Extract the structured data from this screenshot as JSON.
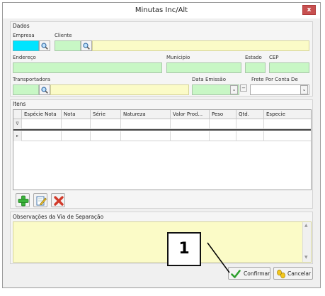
{
  "window": {
    "title": "Minutas Inc/Alt",
    "close_label": "x"
  },
  "dados": {
    "group_label": "Dados",
    "empresa_label": "Empresa",
    "cliente_label": "Cliente",
    "endereco_label": "Endereço",
    "municipio_label": "Municipio",
    "estado_label": "Estado",
    "cep_label": "CEP",
    "transportadora_label": "Transportadora",
    "data_emissao_label": "Data Emissão",
    "frete_label": "Frete Por Conta De"
  },
  "itens": {
    "group_label": "Itens",
    "columns": [
      "Espécie Nota",
      "Nota",
      "Série",
      "Natureza",
      "Valor Prod...",
      "Peso",
      "Qtd.",
      "Especie"
    ],
    "filter_row_indicator": "∇",
    "data_row_indicator": "▸"
  },
  "observacoes": {
    "group_label": "Observações da Via de Separação"
  },
  "buttons": {
    "confirm_label": "Confirmar",
    "cancel_label": "Cancelar"
  },
  "callout": {
    "number": "1"
  },
  "colors": {
    "field_green": "#c8f7c5",
    "field_yellow": "#fbfbc7",
    "field_cyan": "#00e4ff",
    "close_red": "#c75050"
  },
  "icons": [
    "magnifier-icon",
    "add-icon",
    "edit-icon",
    "delete-icon",
    "check-icon",
    "cancel-icon"
  ]
}
